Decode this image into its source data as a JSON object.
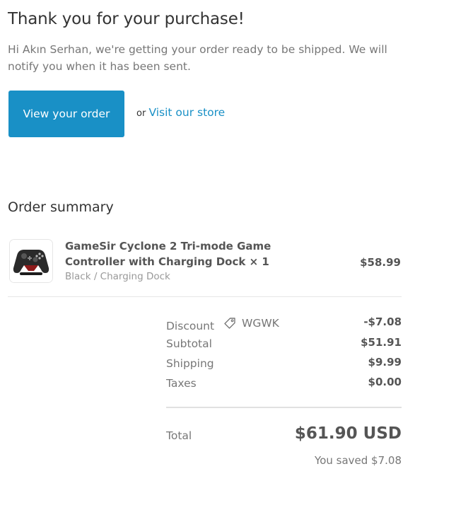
{
  "header": {
    "title": "Thank you for your purchase!",
    "intro": "Hi Akın Serhan, we're getting your order ready to be shipped. We will notify you when it has been sent."
  },
  "actions": {
    "view_order_label": "View your order",
    "or_text": "or",
    "visit_store_label": "Visit our store"
  },
  "summary": {
    "title": "Order summary",
    "item": {
      "name": "GameSir Cyclone 2 Tri-mode Game Controller with Charging Dock × 1",
      "variant": "Black / Charging Dock",
      "price": "$58.99",
      "icon": "controller-image"
    },
    "discount": {
      "label": "Discount",
      "code": "WGWK",
      "value": "-$7.08",
      "icon": "tag-icon"
    },
    "subtotal": {
      "label": "Subtotal",
      "value": "$51.91"
    },
    "shipping": {
      "label": "Shipping",
      "value": "$9.99"
    },
    "taxes": {
      "label": "Taxes",
      "value": "$0.00"
    },
    "total": {
      "label": "Total",
      "value": "$61.90 USD"
    },
    "saved": "You saved $7.08"
  },
  "colors": {
    "accent": "#1990c6",
    "text": "#333333",
    "muted": "#777777"
  }
}
